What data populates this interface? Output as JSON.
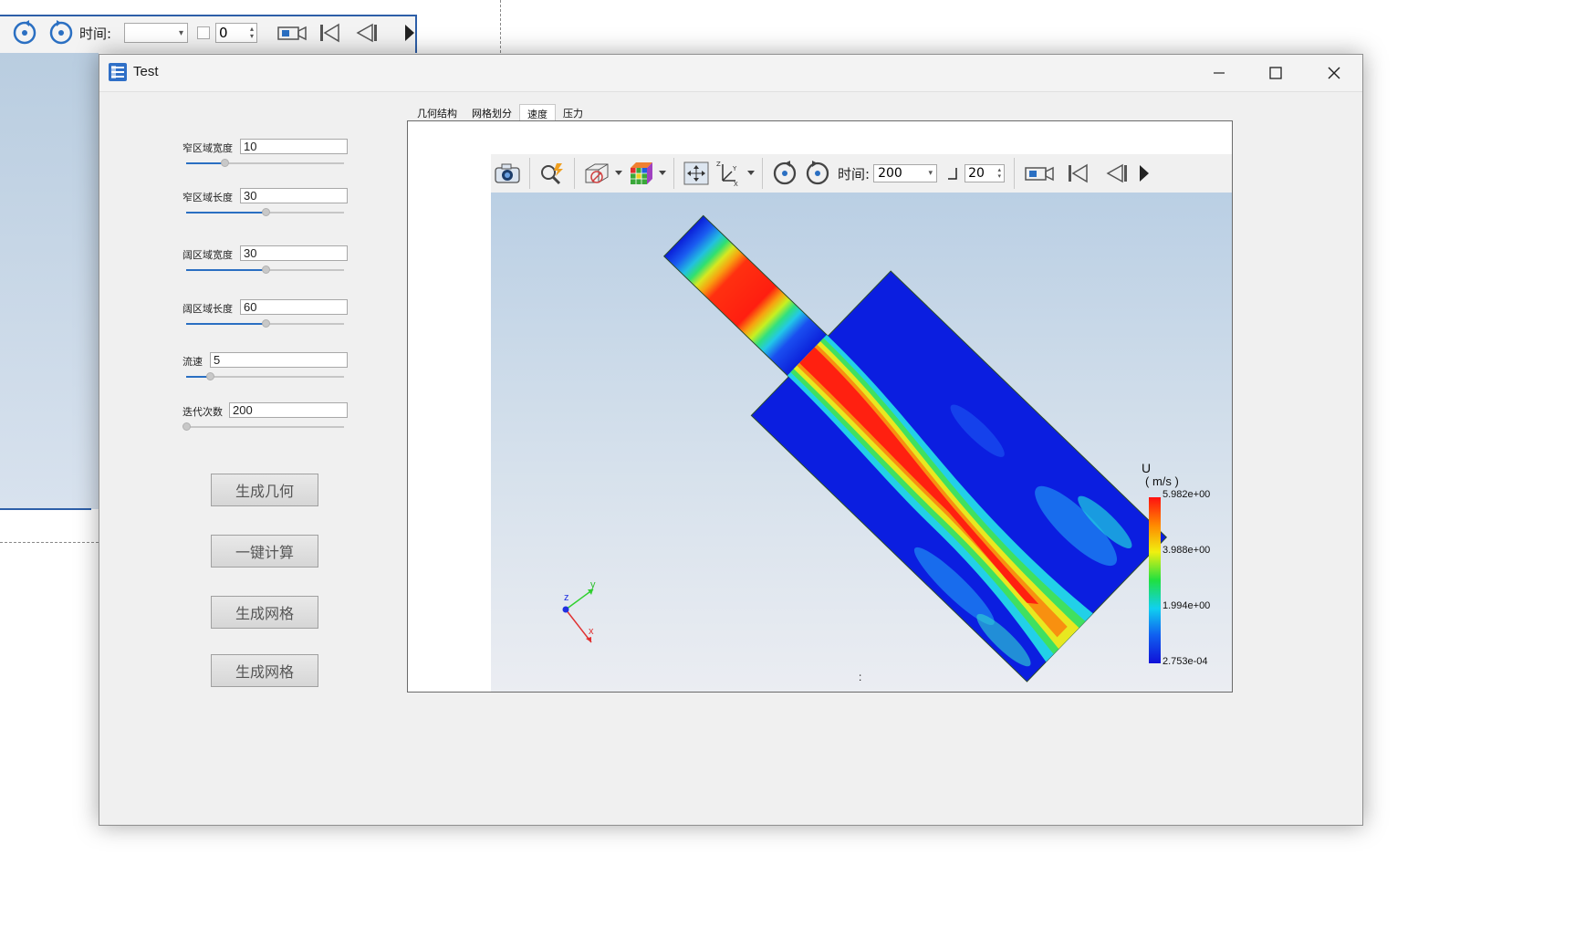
{
  "background_app": {
    "time_label": "时间:",
    "spin_value": "0"
  },
  "window": {
    "title": "Test",
    "controls": {
      "minimize": "–",
      "maximize": "□",
      "close": "✕"
    }
  },
  "params": [
    {
      "label": "窄区域宽度",
      "value": "10",
      "slider": 0.24
    },
    {
      "label": "窄区域长度",
      "value": "30",
      "slider": 0.5
    },
    {
      "label": "阔区域宽度",
      "value": "30",
      "slider": 0.5
    },
    {
      "label": "阔区域长度",
      "value": "60",
      "slider": 0.5
    },
    {
      "label": "流速",
      "value": "5",
      "slider": 0.15
    },
    {
      "label": "迭代次数",
      "value": "200",
      "slider": 0.0
    }
  ],
  "buttons": {
    "gen_geometry": "生成几何",
    "one_click_compute": "一键计算",
    "gen_mesh_1": "生成网格",
    "gen_mesh_2": "生成网格"
  },
  "tabs": [
    {
      "label": "几何结构"
    },
    {
      "label": "网格划分"
    },
    {
      "label": "速度",
      "active": true
    },
    {
      "label": "压力"
    }
  ],
  "viewer": {
    "time_label": "时间:",
    "time_value": "200",
    "step_value": "20",
    "status_text": ":"
  },
  "colorbar": {
    "title": "U",
    "unit": "( m/s )",
    "max": "5.982e+00",
    "v2": "3.988e+00",
    "v1": "1.994e+00",
    "min": "2.753e-04"
  },
  "axes": {
    "x": "x",
    "y": "y",
    "z": "z"
  },
  "colors": {
    "accent": "#2a6fc2",
    "window_bg": "#f0f0f0",
    "toolbar_bg": "#f0f0f0"
  }
}
